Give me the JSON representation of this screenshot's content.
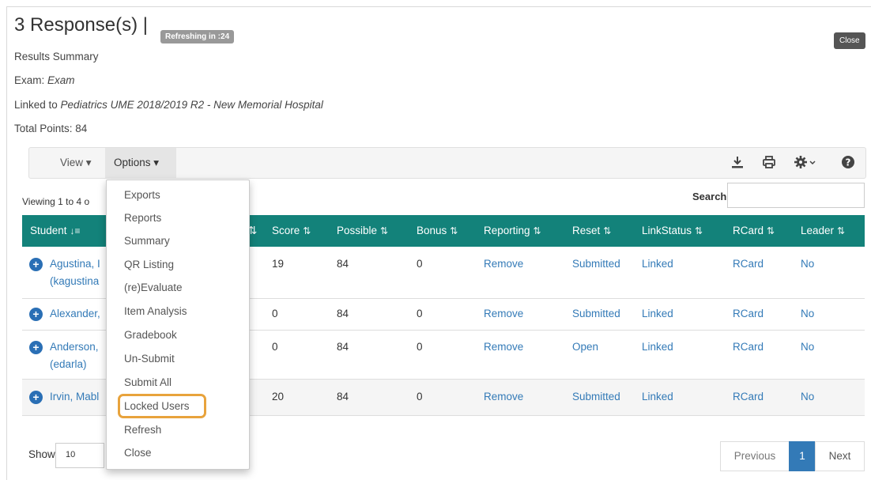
{
  "header": {
    "title": "3 Response(s) |",
    "refresh_badge": "Refreshing in :24",
    "close_label": "Close",
    "results_summary": "Results Summary",
    "exam_label": "Exam: ",
    "exam_value": "Exam",
    "linked_label": "Linked to ",
    "linked_value": "Pediatrics UME 2018/2019 R2 - New Memorial Hospital",
    "total_points": "Total Points: 84"
  },
  "toolbar": {
    "view_label": "View ▾",
    "options_label": "Options ▾",
    "icons": [
      "download-icon",
      "print-icon",
      "gear-icon",
      "help-icon"
    ]
  },
  "table": {
    "viewing_text": "Viewing 1 to 4 o",
    "search_label": "Search:",
    "search_value": "",
    "columns": {
      "student": "Student",
      "score": "Score",
      "possible": "Possible",
      "bonus": "Bonus",
      "reporting": "Reporting",
      "reset": "Reset",
      "linkstatus": "LinkStatus",
      "rcard": "RCard",
      "leader": "Leader"
    },
    "rows": [
      {
        "name": "Agustina, I",
        "sub": "(kagustina",
        "score": "19",
        "possible": "84",
        "bonus": "0",
        "reporting": "Remove",
        "reset": "Submitted",
        "linkstatus": "Linked",
        "rcard": "RCard",
        "leader": "No"
      },
      {
        "name": "Alexander,",
        "sub": "",
        "score": "0",
        "possible": "84",
        "bonus": "0",
        "reporting": "Remove",
        "reset": "Submitted",
        "linkstatus": "Linked",
        "rcard": "RCard",
        "leader": "No"
      },
      {
        "name": "Anderson,",
        "sub": "(edarla)",
        "score": "0",
        "possible": "84",
        "bonus": "0",
        "reporting": "Remove",
        "reset": "Open",
        "linkstatus": "Linked",
        "rcard": "RCard",
        "leader": "No"
      },
      {
        "name": "Irvin, Mabl",
        "sub": "",
        "score": "20",
        "possible": "84",
        "bonus": "0",
        "reporting": "Remove",
        "reset": "Submitted",
        "linkstatus": "Linked",
        "rcard": "RCard",
        "leader": "No"
      }
    ],
    "show_label": "Show",
    "show_value": "10",
    "pagination": {
      "previous": "Previous",
      "current": "1",
      "next": "Next"
    }
  },
  "options_menu": {
    "items": [
      "Exports",
      "Reports",
      "Summary",
      "QR Listing",
      "(re)Evaluate",
      "Item Analysis",
      "Gradebook",
      "Un-Submit",
      "Submit All",
      "Locked Users",
      "Refresh",
      "Close"
    ],
    "highlighted": "Locked Users"
  },
  "colors": {
    "table_header": "#13827a",
    "link": "#337ab7",
    "highlight": "#e8a33c",
    "pager_active": "#337ab7"
  }
}
